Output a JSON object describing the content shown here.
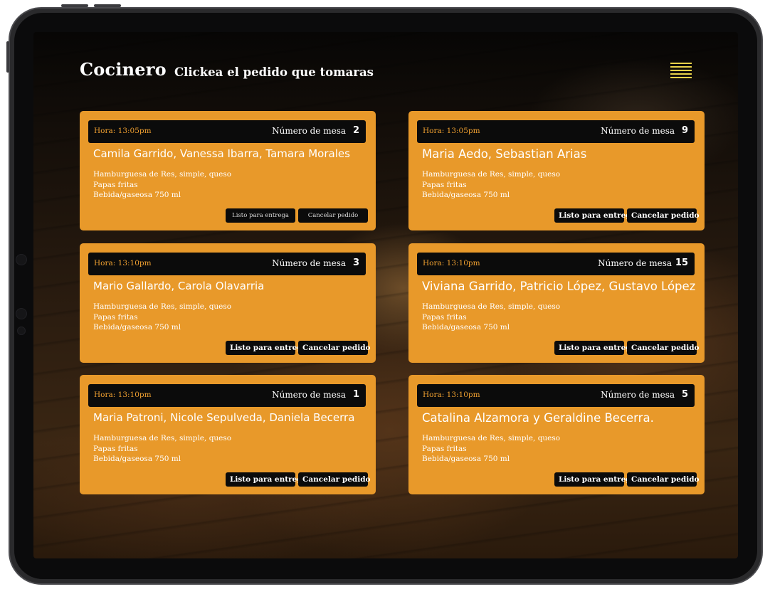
{
  "header": {
    "title": "Cocinero",
    "subtitle": "Clickea el pedido que tomaras"
  },
  "theme": {
    "card_color": "#e8992a",
    "header_bar_color": "#0b0b0b",
    "time_color": "#f0a030",
    "menu_icon_color": "#e8d24a"
  },
  "orders": [
    {
      "time": "Hora: 13:05pm",
      "table_label": "Número de mesa",
      "table_number": "2",
      "names": "Camila Garrido, Vanessa Ibarra, Tamara Morales",
      "items": [
        "Hamburguesa de Res, simple, queso",
        "Papas fritas",
        "Bebida/gaseosa 750 ml"
      ],
      "ready_label": "Listo para entrega",
      "cancel_label": "Cancelar pedido"
    },
    {
      "time": "Hora: 13:05pm",
      "table_label": "Número de mesa",
      "table_number": "9",
      "names": "Maria Aedo, Sebastian Arias",
      "items": [
        "Hamburguesa de Res, simple, queso",
        "Papas fritas",
        "Bebida/gaseosa 750 ml"
      ],
      "ready_label": "Listo para entrega",
      "cancel_label": "Cancelar pedido"
    },
    {
      "time": "Hora: 13:10pm",
      "table_label": "Número de mesa",
      "table_number": "3",
      "names": "Mario Gallardo, Carola Olavarria",
      "items": [
        "Hamburguesa de Res, simple, queso",
        "Papas fritas",
        "Bebida/gaseosa 750 ml"
      ],
      "ready_label": "Listo para entrega",
      "cancel_label": "Cancelar pedido"
    },
    {
      "time": "Hora: 13:10pm",
      "table_label": "Número de mesa",
      "table_number": "15",
      "names": "Viviana Garrido, Patricio López, Gustavo López",
      "items": [
        "Hamburguesa de Res, simple, queso",
        "Papas fritas",
        "Bebida/gaseosa 750 ml"
      ],
      "ready_label": "Listo para entrega",
      "cancel_label": "Cancelar pedido"
    },
    {
      "time": "Hora: 13:10pm",
      "table_label": "Número de mesa",
      "table_number": "1",
      "names": "Maria Patroni, Nicole Sepulveda, Daniela Becerra",
      "items": [
        "Hamburguesa de Res, simple, queso",
        "Papas fritas",
        "Bebida/gaseosa 750 ml"
      ],
      "ready_label": "Listo para entrega",
      "cancel_label": "Cancelar pedido"
    },
    {
      "time": "Hora: 13:10pm",
      "table_label": "Número de mesa",
      "table_number": "5",
      "names": "Catalina Alzamora y Geraldine Becerra.",
      "items": [
        "Hamburguesa de Res, simple, queso",
        "Papas fritas",
        "Bebida/gaseosa 750 ml"
      ],
      "ready_label": "Listo para entrega",
      "cancel_label": "Cancelar pedido"
    }
  ]
}
